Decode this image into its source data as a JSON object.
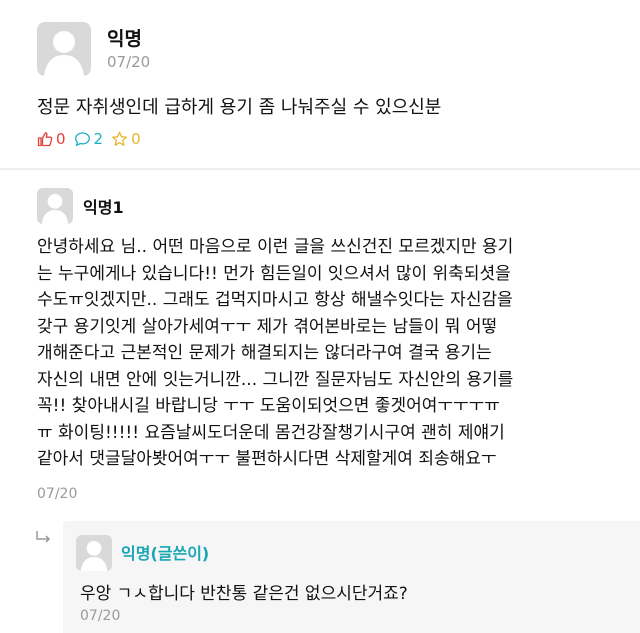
{
  "post": {
    "author": "익명",
    "date": "07/20",
    "body": "정문 자취생인데 급하게 용기 좀 나눠주실 수 있으신분",
    "likes": "0",
    "comments": "2",
    "scraps": "0"
  },
  "comment": {
    "author": "익명1",
    "lines": [
      "안녕하세요 님.. 어떤 마음으로 이런 글을 쓰신건진 모르겠지만 용기",
      "는 누구에게나 있습니다!! 먼가 힘든일이 잇으셔서 많이 위축되셧을",
      "수도ㅠ잇겠지만.. 그래도 겁먹지마시고 항상 해낼수잇다는 자신감을",
      "갖구 용기잇게 살아가세여ㅜㅜ 제가 겪어본바로는 남들이 뭐 어떻",
      "개해준다고 근본적인 문제가 해결되지는 않더라구여 결국 용기는",
      "자신의 내면 안에 잇는거니깐... 그니깐 질문자님도 자신안의 용기를",
      "꼭!! 찾아내시길 바랍니당 ㅜㅜ 도움이되엇으면 좋겟어여ㅜㅜㅜㅠ",
      "ㅠ 화이팅!!!!! 요즘날씨도더운데 몸건강잘챙기시구여 괜히 제얘기",
      "같아서 댓글달아봣어여ㅜㅜ 불편하시다면 삭제할게여 죄송해요ㅜ"
    ],
    "date": "07/20"
  },
  "reply": {
    "author": "익명(글쓴이)",
    "body": "우앙 ㄱㅅ합니다 반찬통 같은건 없으시단거죠?",
    "date": "07/20"
  },
  "colors": {
    "like": "#e0413a",
    "comment": "#1ab0c9",
    "scrap": "#e8b62c",
    "op_name": "#1aa6b5"
  },
  "icons": {
    "like": "thumbs-up-icon",
    "comment": "speech-bubble-icon",
    "scrap": "star-icon",
    "reply": "reply-arrow-icon",
    "avatar": "default-avatar-icon"
  }
}
